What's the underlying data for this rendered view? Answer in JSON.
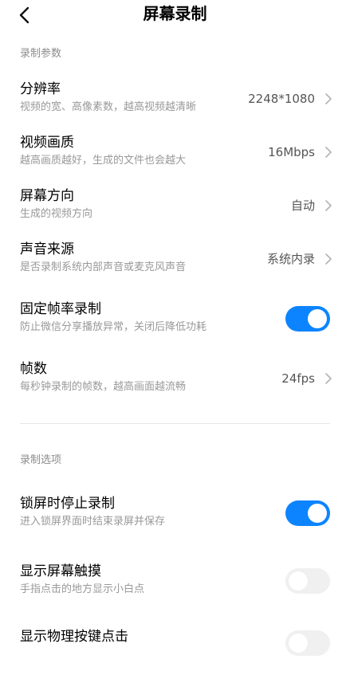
{
  "header": {
    "title": "屏幕录制",
    "back_icon": "chevron-left-icon"
  },
  "colors": {
    "accent": "#0d84ff",
    "toggle_off": "#f0f0f0",
    "section_label": "#8c8c8c",
    "subtitle": "#999999"
  },
  "sections": [
    {
      "label": "录制参数",
      "items": [
        {
          "title": "分辨率",
          "subtitle": "视频的宽、高像素数，越高视频越清晰",
          "value": "2248*1080",
          "control": "chevron"
        },
        {
          "title": "视频画质",
          "subtitle": "越高画质越好，生成的文件也会越大",
          "value": "16Mbps",
          "control": "chevron"
        },
        {
          "title": "屏幕方向",
          "subtitle": "生成的视频方向",
          "value": "自动",
          "control": "chevron"
        },
        {
          "title": "声音来源",
          "subtitle": "是否录制系统内部声音或麦克风声音",
          "value": "系统内录",
          "control": "chevron"
        },
        {
          "title": "固定帧率录制",
          "subtitle": "防止微信分享播放异常，关闭后降低功耗",
          "control": "toggle",
          "checked": true
        },
        {
          "title": "帧数",
          "subtitle": "每秒钟录制的帧数，越高画面越流畅",
          "value": "24fps",
          "control": "chevron"
        }
      ]
    },
    {
      "label": "录制选项",
      "items": [
        {
          "title": "锁屏时停止录制",
          "subtitle": "进入锁屏界面时结束录屏并保存",
          "control": "toggle",
          "checked": true
        },
        {
          "title": "显示屏幕触摸",
          "subtitle": "手指点击的地方显示小白点",
          "control": "toggle",
          "checked": false
        },
        {
          "title": "显示物理按键点击",
          "control": "toggle",
          "checked": false
        }
      ]
    }
  ]
}
